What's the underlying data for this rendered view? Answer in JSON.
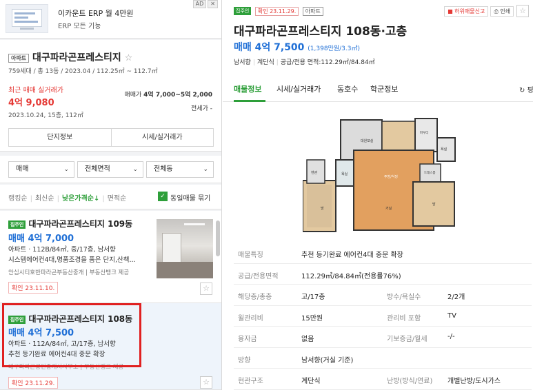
{
  "ad": {
    "title": "이카운트 ERP 월 4만원",
    "subtitle": "ERP 모든 기능",
    "badge": "AD",
    "close": "✕"
  },
  "summary": {
    "type_tag": "아파트",
    "title": "대구파라곤프레스티지",
    "star": "☆",
    "meta": "759세대 / 총 13동 / 2023.04 / 112.25㎡ ~ 112.7㎡",
    "recent_label": "최근 매매 실거래가",
    "recent_price": "4억 9,080",
    "recent_date": "2023.10.24, 15층, 112㎡",
    "sale_label": "매매가",
    "sale_range": "4억 7,000~5억 2,000",
    "rent_label": "전세가",
    "rent_value": "-",
    "btn_complex": "단지정보",
    "btn_market": "시세/실거래가"
  },
  "filters": {
    "trade": "매매",
    "area": "전체면적",
    "dong": "전체동"
  },
  "sort": {
    "options": [
      "랭킹순",
      "최신순",
      "낮은가격순↓",
      "면적순"
    ],
    "active_index": 2,
    "check_label": "동일매물 묶기",
    "check_mark": "✓"
  },
  "listings": [
    {
      "tag": "집주인",
      "title": "대구파라곤프레스티지 109동",
      "price": "매매 4억 7,000",
      "spec": "아파트 · 112B/84㎡, 중/17층, 남서향",
      "desc": "시스템에어컨4대,명품조경을 품은 단지,산책...",
      "agent": "안심시티호반파라곤부동산중개 | 부동산뱅크 제공",
      "confirm": "확인 23.11.10.",
      "star": "☆"
    },
    {
      "tag": "집주인",
      "title": "대구파라곤프레스티지 108동",
      "price": "매매 4억 7,500",
      "spec": "아파트 · 112A/84㎡, 고/17층, 남서향",
      "desc": "추천 등기완료 에어컨4대 중문 확장",
      "agent": "대구파라곤공인중개사사무소 | 부동산뱅크 제공",
      "confirm": "확인 23.11.29.",
      "star": "☆"
    }
  ],
  "detail": {
    "tag_owner": "집주인",
    "tag_confirm": "확인 23.11.29.",
    "tag_type": "아파트",
    "report": "■ 허위매물신고",
    "print": "⎙ 인쇄",
    "star": "☆",
    "title": "대구파라곤프레스티지 108동·고층",
    "price": "매매 4억 7,500",
    "price_per": "(1,398만원/3.3㎡)",
    "meta": [
      "남서향",
      "계단식",
      "공급/전용 면적:112.29㎡/84.84㎡"
    ],
    "tabs": [
      "매물정보",
      "시세/실거래가",
      "동호수",
      "학군정보"
    ],
    "active_tab": 0,
    "refresh": "↻ 평"
  },
  "floorplan_labels": {
    "room_a": "대원포실",
    "room_b": "방",
    "room_c": "방",
    "living": "거실",
    "kitchen": "주방/식당",
    "bath1": "욕실",
    "bath2": "욕실",
    "pantry": "드레스룸",
    "dress": "파우더",
    "entrance": "현관"
  },
  "info_rows": [
    {
      "label": "매물특징",
      "value": "추천 등기완료 에어컨4대 중문 확장"
    },
    {
      "label": "공급/전용면적",
      "value": "112.29㎡/84.84㎡(전용률76%)"
    },
    {
      "label": "해당층/총층",
      "value": "고/17층",
      "label2": "방수/욕실수",
      "value2": "2/2개"
    },
    {
      "label": "월관리비",
      "value": "15만원",
      "label2": "관리비 포함",
      "value2": "TV"
    },
    {
      "label": "융자금",
      "value": "없음",
      "label2": "기보증금/월세",
      "value2": "-/-"
    },
    {
      "label": "방향",
      "value": "남서향(거실 기준)"
    },
    {
      "label": "현관구조",
      "value": "계단식",
      "label2": "난방(방식/연료)",
      "value2": "개별난방/도시가스"
    }
  ],
  "colors": {
    "accent_green": "#2e9f3a",
    "price_blue": "#1f6fd6",
    "alert_red": "#e53935",
    "highlight_box": "#e02020"
  }
}
